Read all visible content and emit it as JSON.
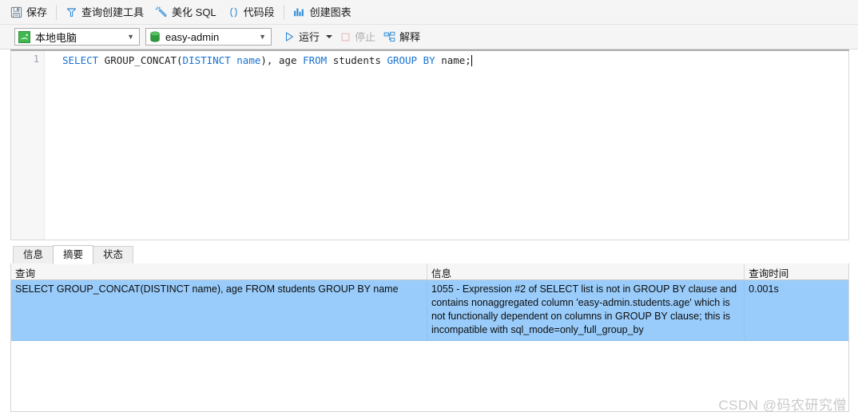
{
  "toolbar": {
    "items": [
      {
        "label": "保存",
        "icon": "save-icon"
      },
      {
        "label": "查询创建工具",
        "icon": "query-builder-icon"
      },
      {
        "label": "美化 SQL",
        "icon": "beautify-sql-icon"
      },
      {
        "label": "代码段",
        "icon": "code-snippet-icon"
      },
      {
        "label": "创建图表",
        "icon": "create-chart-icon"
      }
    ]
  },
  "toolbar2": {
    "connection": {
      "value": "本地电脑",
      "icon": "mysql-connection-icon"
    },
    "database": {
      "value": "easy-admin",
      "icon": "database-icon"
    },
    "run": {
      "label": "运行",
      "icon": "play-icon"
    },
    "stop": {
      "label": "停止",
      "icon": "stop-icon",
      "enabled": false
    },
    "explain": {
      "label": "解释",
      "icon": "explain-icon"
    }
  },
  "editor": {
    "line_number": "1",
    "sql_tokens": [
      {
        "text": "SELECT",
        "type": "keyword"
      },
      {
        "text": " GROUP_CONCAT(",
        "type": "plain"
      },
      {
        "text": "DISTINCT",
        "type": "keyword"
      },
      {
        "text": " ",
        "type": "plain"
      },
      {
        "text": "name",
        "type": "keyword"
      },
      {
        "text": "), age ",
        "type": "plain"
      },
      {
        "text": "FROM",
        "type": "keyword"
      },
      {
        "text": " students ",
        "type": "plain"
      },
      {
        "text": "GROUP",
        "type": "keyword"
      },
      {
        "text": " ",
        "type": "plain"
      },
      {
        "text": "BY",
        "type": "keyword"
      },
      {
        "text": " name;",
        "type": "plain"
      }
    ],
    "sql_text": "SELECT GROUP_CONCAT(DISTINCT name), age FROM students GROUP BY name;"
  },
  "result_tabs": [
    {
      "label": "信息",
      "active": false
    },
    {
      "label": "摘要",
      "active": true
    },
    {
      "label": "状态",
      "active": false
    }
  ],
  "result_grid": {
    "columns": [
      "查询",
      "信息",
      "查询时间"
    ],
    "rows": [
      {
        "query": "SELECT GROUP_CONCAT(DISTINCT name), age FROM students GROUP BY name",
        "message": "1055 - Expression #2 of SELECT list is not in GROUP BY clause and contains nonaggregated column 'easy-admin.students.age' which is not functionally dependent on columns in GROUP BY clause; this is incompatible with sql_mode=only_full_group_by",
        "time": "0.001s"
      }
    ]
  },
  "watermark": {
    "text": "CSDN @码农研究僧"
  },
  "colors": {
    "accent": "#1673d2",
    "row_selected": "#99ccfb",
    "toolbar_bg": "#f5f5f5",
    "db_green": "#27a043"
  }
}
